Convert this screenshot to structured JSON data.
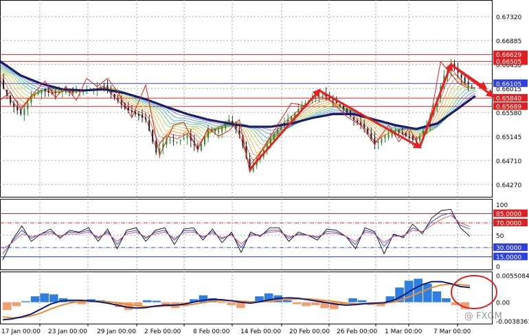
{
  "chart_data": {
    "type": "line",
    "instrument_note": "",
    "panels": {
      "price": {
        "yticks": [
          0.6732,
          0.66885,
          0.6645,
          0.66015,
          0.6558,
          0.65145,
          0.6471,
          0.64275
        ],
        "ytick_labels": [
          "0.67320",
          "0.66885",
          "0.66450",
          "0.66015",
          "0.65580",
          "0.65145",
          "0.64710",
          "0.64270"
        ],
        "ylim": [
          0.6405,
          0.6762
        ],
        "price_levels": [
          {
            "label": "0.66629",
            "value": 0.66629,
            "color": "#e02020"
          },
          {
            "label": "0.66505",
            "value": 0.66505,
            "color": "#e02020"
          },
          {
            "label": "0.66105",
            "value": 0.66105,
            "color": "#3040e0"
          },
          {
            "label": "0.65840",
            "value": 0.6584,
            "color": "#e02020"
          },
          {
            "label": "0.65689",
            "value": 0.65689,
            "color": "#e02020"
          }
        ],
        "pivot_path": [
          [
            0,
            0.658
          ],
          [
            3,
            0.6595
          ],
          [
            6,
            0.6565
          ],
          [
            10,
            0.6595
          ],
          [
            13,
            0.6615
          ],
          [
            16,
            0.6585
          ],
          [
            19,
            0.6605
          ],
          [
            22,
            0.658
          ],
          [
            25,
            0.662
          ],
          [
            28,
            0.6605
          ],
          [
            31,
            0.662
          ],
          [
            34,
            0.6595
          ],
          [
            38,
            0.6548
          ],
          [
            42,
            0.6608
          ],
          [
            46,
            0.648
          ],
          [
            50,
            0.6535
          ],
          [
            53,
            0.654
          ],
          [
            57,
            0.649
          ],
          [
            60,
            0.653
          ],
          [
            63,
            0.6515
          ],
          [
            66,
            0.6525
          ],
          [
            69,
            0.6545
          ],
          [
            72,
            0.645
          ],
          [
            76,
            0.6495
          ],
          [
            80,
            0.6535
          ],
          [
            84,
            0.6575
          ],
          [
            88,
            0.657
          ],
          [
            92,
            0.6598
          ],
          [
            96,
            0.6575
          ],
          [
            100,
            0.655
          ],
          [
            104,
            0.6535
          ],
          [
            108,
            0.65
          ],
          [
            112,
            0.6535
          ],
          [
            115,
            0.6505
          ],
          [
            118,
            0.653
          ],
          [
            121,
            0.6495
          ],
          [
            124,
            0.6545
          ],
          [
            127,
            0.665
          ],
          [
            130,
            0.6628
          ],
          [
            132,
            0.6612
          ],
          [
            135,
            0.6602
          ]
        ],
        "close_path": [
          [
            0,
            0.6615
          ],
          [
            3,
            0.6575
          ],
          [
            6,
            0.6555
          ],
          [
            9,
            0.6585
          ],
          [
            12,
            0.6598
          ],
          [
            15,
            0.6592
          ],
          [
            18,
            0.6596
          ],
          [
            21,
            0.6594
          ],
          [
            24,
            0.6598
          ],
          [
            27,
            0.66
          ],
          [
            30,
            0.6606
          ],
          [
            33,
            0.6585
          ],
          [
            36,
            0.6565
          ],
          [
            39,
            0.6555
          ],
          [
            42,
            0.6545
          ],
          [
            45,
            0.6485
          ],
          [
            48,
            0.651
          ],
          [
            51,
            0.6505
          ],
          [
            54,
            0.6515
          ],
          [
            57,
            0.649
          ],
          [
            60,
            0.6525
          ],
          [
            63,
            0.6525
          ],
          [
            66,
            0.6545
          ],
          [
            69,
            0.6518
          ],
          [
            72,
            0.6455
          ],
          [
            75,
            0.648
          ],
          [
            78,
            0.651
          ],
          [
            81,
            0.6535
          ],
          [
            84,
            0.6552
          ],
          [
            87,
            0.657
          ],
          [
            90,
            0.6585
          ],
          [
            93,
            0.659
          ],
          [
            96,
            0.658
          ],
          [
            99,
            0.6565
          ],
          [
            102,
            0.6545
          ],
          [
            105,
            0.653
          ],
          [
            108,
            0.65
          ],
          [
            111,
            0.6515
          ],
          [
            114,
            0.6525
          ],
          [
            117,
            0.6515
          ],
          [
            120,
            0.6505
          ],
          [
            123,
            0.6535
          ],
          [
            126,
            0.6585
          ],
          [
            128,
            0.6625
          ],
          [
            130,
            0.6645
          ],
          [
            132,
            0.663
          ],
          [
            134,
            0.6612
          ],
          [
            136,
            0.6605
          ]
        ],
        "slow_ma": [
          [
            0,
            0.6651
          ],
          [
            6,
            0.6625
          ],
          [
            12,
            0.661
          ],
          [
            18,
            0.66
          ],
          [
            24,
            0.6598
          ],
          [
            30,
            0.66
          ],
          [
            36,
            0.6593
          ],
          [
            42,
            0.6582
          ],
          [
            48,
            0.6568
          ],
          [
            54,
            0.6555
          ],
          [
            60,
            0.6545
          ],
          [
            66,
            0.6538
          ],
          [
            72,
            0.6532
          ],
          [
            78,
            0.6532
          ],
          [
            84,
            0.6538
          ],
          [
            90,
            0.6548
          ],
          [
            96,
            0.6555
          ],
          [
            102,
            0.6555
          ],
          [
            108,
            0.6545
          ],
          [
            114,
            0.6535
          ],
          [
            120,
            0.6528
          ],
          [
            126,
            0.6538
          ],
          [
            132,
            0.6565
          ],
          [
            137,
            0.6588
          ]
        ],
        "arrows": [
          {
            "from": [
              72,
              0.6455
            ],
            "to": [
              92,
              0.6598
            ]
          },
          {
            "from": [
              92,
              0.6598
            ],
            "to": [
              121,
              0.6495
            ]
          },
          {
            "from": [
              121,
              0.6495
            ],
            "to": [
              130,
              0.6645
            ]
          },
          {
            "from": [
              130,
              0.6645
            ],
            "to": [
              140,
              0.6602
            ]
          },
          {
            "from": [
              130,
              0.6645
            ],
            "to": [
              142,
              0.6588
            ]
          }
        ]
      },
      "oscillator": {
        "ytick_labels": [
          "100",
          "50",
          "0"
        ],
        "yticks": [
          100,
          50,
          0
        ],
        "ylim": [
          0,
          100
        ],
        "levels": [
          {
            "label": "85.0000",
            "value": 85,
            "style": "solid"
          },
          {
            "label": "70.0000",
            "value": 70,
            "style": "dashdot"
          },
          {
            "label": "30.0000",
            "value": 30,
            "style": "dashdot"
          },
          {
            "label": "15.0000",
            "value": 15,
            "style": "solid"
          }
        ],
        "series": [
          {
            "color": "#000000",
            "values": [
              10,
              42,
              65,
              40,
              52,
              60,
              45,
              58,
              55,
              62,
              40,
              60,
              28,
              58,
              62,
              40,
              58,
              62,
              35,
              60,
              62,
              42,
              60,
              38,
              55,
              22,
              55,
              48,
              62,
              62,
              40,
              55,
              50,
              42,
              60,
              58,
              48,
              28,
              62,
              56,
              20,
              52,
              46,
              68,
              52,
              78,
              90,
              92,
              62,
              48
            ]
          },
          {
            "color": "#1e3ad6",
            "values": [
              20,
              40,
              58,
              45,
              52,
              56,
              48,
              55,
              54,
              58,
              45,
              56,
              35,
              55,
              58,
              45,
              55,
              58,
              42,
              57,
              58,
              46,
              56,
              44,
              52,
              30,
              52,
              50,
              58,
              58,
              45,
              52,
              50,
              46,
              56,
              55,
              48,
              35,
              58,
              54,
              32,
              50,
              48,
              62,
              55,
              72,
              82,
              86,
              66,
              60
            ]
          },
          {
            "color": "#e04a4a",
            "values": [
              28,
              38,
              52,
              48,
              50,
              53,
              49,
              52,
              52,
              55,
              47,
              53,
              40,
              52,
              55,
              47,
              52,
              55,
              45,
              54,
              55,
              48,
              53,
              46,
              50,
              36,
              49,
              50,
              55,
              56,
              48,
              50,
              50,
              48,
              53,
              53,
              48,
              40,
              55,
              52,
              38,
              48,
              49,
              58,
              56,
              66,
              76,
              82,
              70,
              64
            ]
          }
        ]
      },
      "macd": {
        "ytick_labels": [
          "0.0055084",
          "0.00",
          "-0.0038361"
        ],
        "yticks": [
          0.0055084,
          0.0,
          -0.0038361
        ],
        "ylim": [
          -0.0041,
          0.0057
        ],
        "histogram": [
          -0.0016,
          -0.0008,
          0.0002,
          0.0012,
          0.0018,
          0.0016,
          0.0008,
          0.0002,
          -0.0004,
          0.0006,
          0.0004,
          -0.0002,
          -0.001,
          -0.0016,
          -0.0008,
          0.0004,
          0.0003,
          -0.0006,
          -0.0012,
          -0.0008,
          0.0006,
          0.0014,
          0.0008,
          -0.0002,
          -0.0006,
          -0.0012,
          0.0002,
          0.0012,
          0.0018,
          0.0014,
          0.0004,
          -0.0004,
          -0.0008,
          -0.0006,
          -0.0012,
          -0.0014,
          -0.0004,
          0.0008,
          0.0004,
          -0.0006,
          -0.0008,
          0.0012,
          0.003,
          0.0044,
          0.0048,
          0.0038,
          0.0022,
          0.0008,
          -0.0006,
          -0.0014
        ],
        "macd_line": [
          -0.0036,
          -0.0034,
          -0.003,
          -0.0024,
          -0.0014,
          -0.0004,
          0.0002,
          0.0004,
          0.0004,
          0.0003,
          0.0001,
          -0.0002,
          -0.0006,
          -0.001,
          -0.0012,
          -0.0011,
          -0.0008,
          -0.0006,
          -0.0006,
          -0.0004,
          0.0,
          0.0004,
          0.0006,
          0.0005,
          0.0003,
          0.0,
          -0.0002,
          0.0001,
          0.0005,
          0.0008,
          0.0009,
          0.0008,
          0.0005,
          0.0002,
          -0.0001,
          -0.0004,
          -0.0006,
          -0.0005,
          -0.0003,
          -0.0002,
          -0.0001,
          0.0004,
          0.0014,
          0.0026,
          0.0036,
          0.0042,
          0.0042,
          0.0038,
          0.0032,
          0.003
        ],
        "signal_line": [
          -0.003,
          -0.0032,
          -0.0031,
          -0.0028,
          -0.0022,
          -0.0014,
          -0.0007,
          -0.0002,
          0.0001,
          0.0002,
          0.0002,
          0.0001,
          -0.0001,
          -0.0004,
          -0.0007,
          -0.0009,
          -0.0009,
          -0.0008,
          -0.0007,
          -0.0006,
          -0.0004,
          -0.0001,
          0.0002,
          0.0003,
          0.0003,
          0.0002,
          0.0001,
          0.0001,
          0.0002,
          0.0004,
          0.0006,
          0.0007,
          0.0007,
          0.0005,
          0.0003,
          0.0001,
          -0.0002,
          -0.0003,
          -0.0003,
          -0.0003,
          -0.0002,
          0.0,
          0.0006,
          0.0014,
          0.0022,
          0.003,
          0.0035,
          0.0037,
          0.0036,
          0.0034
        ]
      }
    },
    "x_tick_labels": [
      "17 Jan 00:00",
      "23 Jan 00:00",
      "29 Jan 00:00",
      "2 Feb 00:00",
      "8 Feb 00:00",
      "14 Feb 00:00",
      "20 Feb 00:00",
      "26 Feb 00:00",
      "1 Mar 00:00",
      "7 Mar 00:00"
    ],
    "watermark": "@ FXGM",
    "colors": {
      "level_red": "#e02020",
      "level_blue": "#3040e0",
      "arrow": "#e82020",
      "slow_ma": "#1c1c6e",
      "hist_pos": "#2f7fe0",
      "hist_neg": "#f0a070",
      "macd_line": "#0a1a7a",
      "signal_line": "#f08a2a",
      "grid": "#a0a0a0"
    }
  }
}
